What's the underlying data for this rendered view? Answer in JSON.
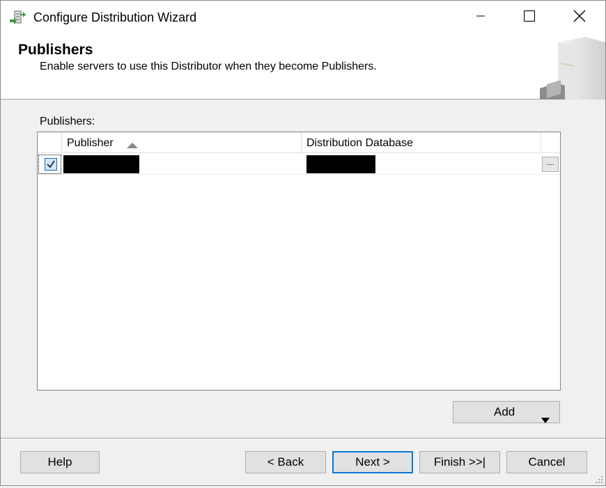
{
  "window": {
    "title": "Configure Distribution Wizard",
    "icons": {
      "app": "wizard-app-icon",
      "minimize": "minimize-icon",
      "maximize": "maximize-icon",
      "close": "close-icon"
    }
  },
  "header": {
    "title": "Publishers",
    "subtitle": "Enable servers to use this Distributor when they become Publishers."
  },
  "publishers": {
    "label": "Publishers:",
    "columns": [
      "Publisher",
      "Distribution Database"
    ],
    "sort": "ascending",
    "rows": [
      {
        "checked": true,
        "publisher": "[redacted]",
        "distribution_database": "[redacted]",
        "browse_label": "...."
      }
    ]
  },
  "add_button": {
    "label": "Add"
  },
  "footer": {
    "help": "Help",
    "back": "< Back",
    "next": "Next >",
    "finish": "Finish >>|",
    "cancel": "Cancel"
  },
  "colors": {
    "accent": "#0078d7",
    "checkbox_fill": "#cfe6fb",
    "button_face": "#e1e1e1"
  }
}
